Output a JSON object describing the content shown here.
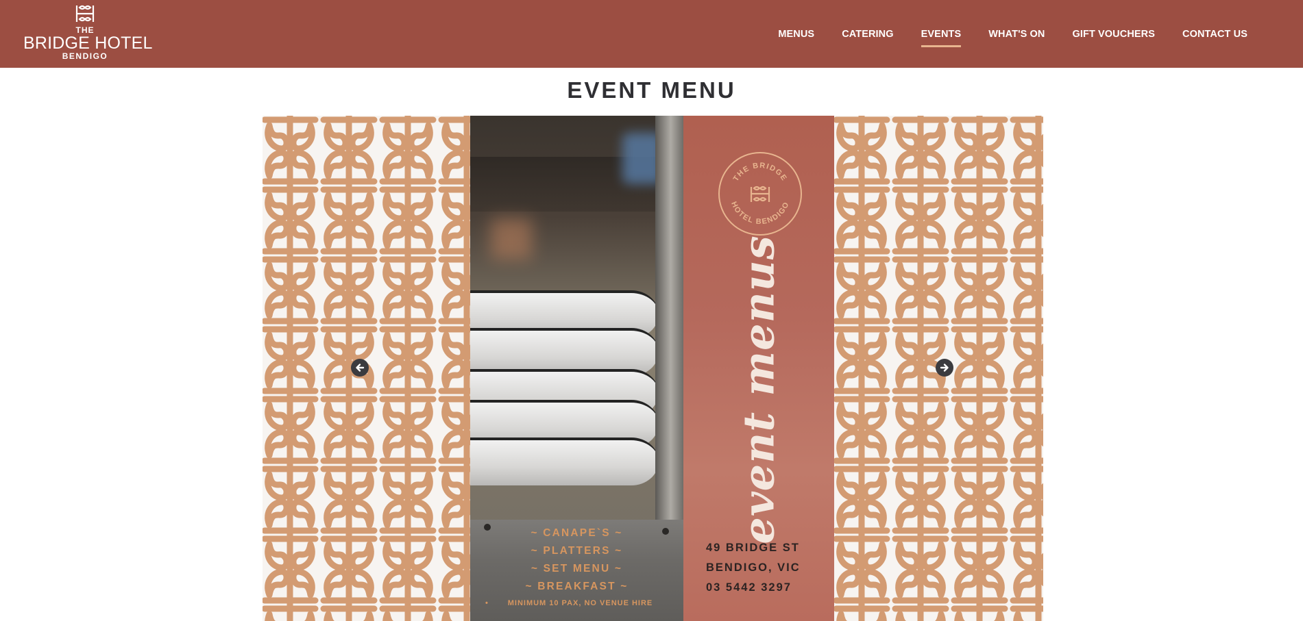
{
  "brand": {
    "the": "THE",
    "name": "BRIDGE HOTEL",
    "sub": "BENDIGO",
    "color_header": "#9c4e42",
    "color_accent": "#e8b58f"
  },
  "nav": {
    "items": [
      {
        "label": "MENUS"
      },
      {
        "label": "CATERING"
      },
      {
        "label": "EVENTS",
        "active": true
      },
      {
        "label": "WHAT'S ON"
      },
      {
        "label": "GIFT VOUCHERS"
      },
      {
        "label": "CONTACT US"
      }
    ]
  },
  "page": {
    "title": "EVENT MENU"
  },
  "slide": {
    "script_title": "event menus",
    "seal": {
      "top_text": "THE BRIDGE",
      "bottom_text": "HOTEL BENDIGO"
    },
    "menu_lines": [
      "~ CANAPE`S ~",
      "~ PLATTERS ~",
      "~ SET MENU ~",
      "~ BREAKFAST ~"
    ],
    "note": "MINIMUM 10 PAX, NO VENUE HIRE",
    "address": [
      "49 BRIDGE ST",
      "BENDIGO, VIC",
      "03 5442 3297"
    ],
    "pattern_color": "#d39b72",
    "panel_color": "#b5695c"
  },
  "carousel": {
    "prev_icon": "arrow-left-circle-icon",
    "next_icon": "arrow-right-circle-icon"
  }
}
